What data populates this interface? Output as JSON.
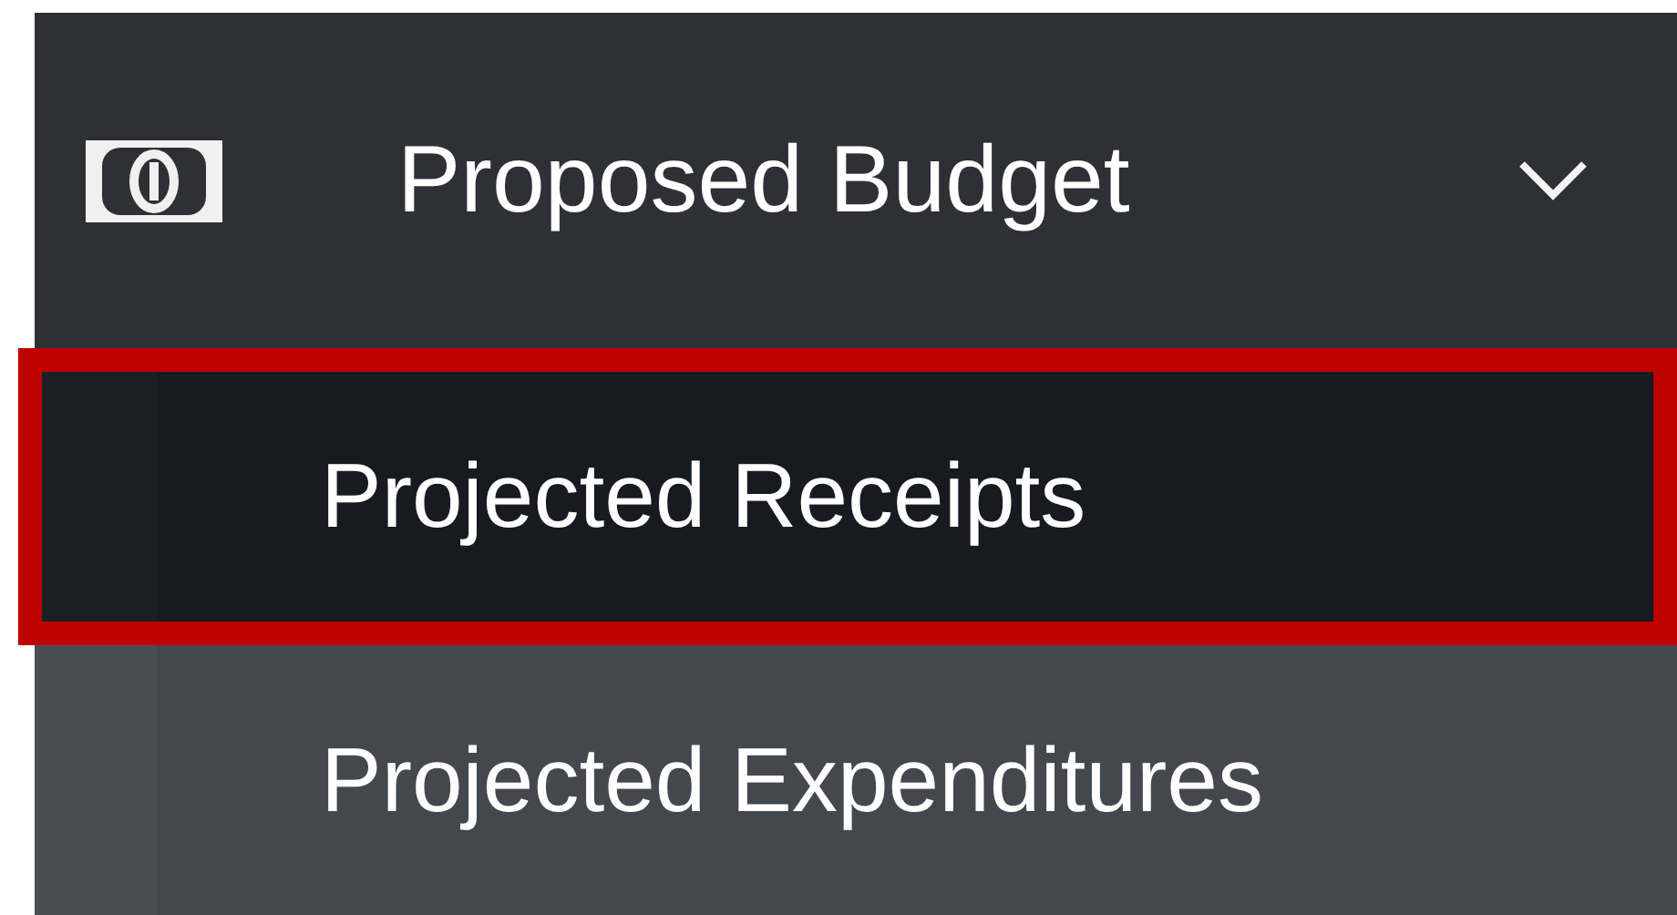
{
  "menu": {
    "label": "Proposed Budget",
    "expanded": true,
    "children": [
      {
        "label": "Projected Receipts",
        "selected": true
      },
      {
        "label": "Projected Expenditures",
        "selected": false
      }
    ]
  }
}
